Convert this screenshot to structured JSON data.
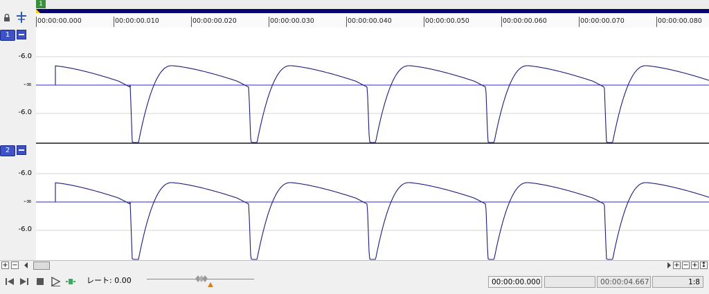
{
  "marker": {
    "label": "1"
  },
  "ruler": {
    "ticks": [
      "00:00:00.000",
      "00:00:00.010",
      "00:00:00.020",
      "00:00:00.030",
      "00:00:00.040",
      "00:00:00.050",
      "00:00:00.060",
      "00:00:00.070",
      "00:00:00.080"
    ]
  },
  "tracks": [
    {
      "number": "1",
      "db_labels": [
        "-6.0",
        "-∞",
        "-6.0"
      ]
    },
    {
      "number": "2",
      "db_labels": [
        "-6.0",
        "-∞",
        "-6.0"
      ]
    }
  ],
  "transport": {
    "rate_label": "レート:",
    "rate_value": "0.00"
  },
  "status": {
    "cursor_time": "00:00:00.000",
    "selection_start": "",
    "length": "00:00:04.667",
    "extra": "",
    "zoom": "1:8"
  },
  "colors": {
    "waveform": "#1a1a7a",
    "center_line": "#2a2acc",
    "time_bar": "#06066e",
    "track_badge": "#3e52c8"
  }
}
